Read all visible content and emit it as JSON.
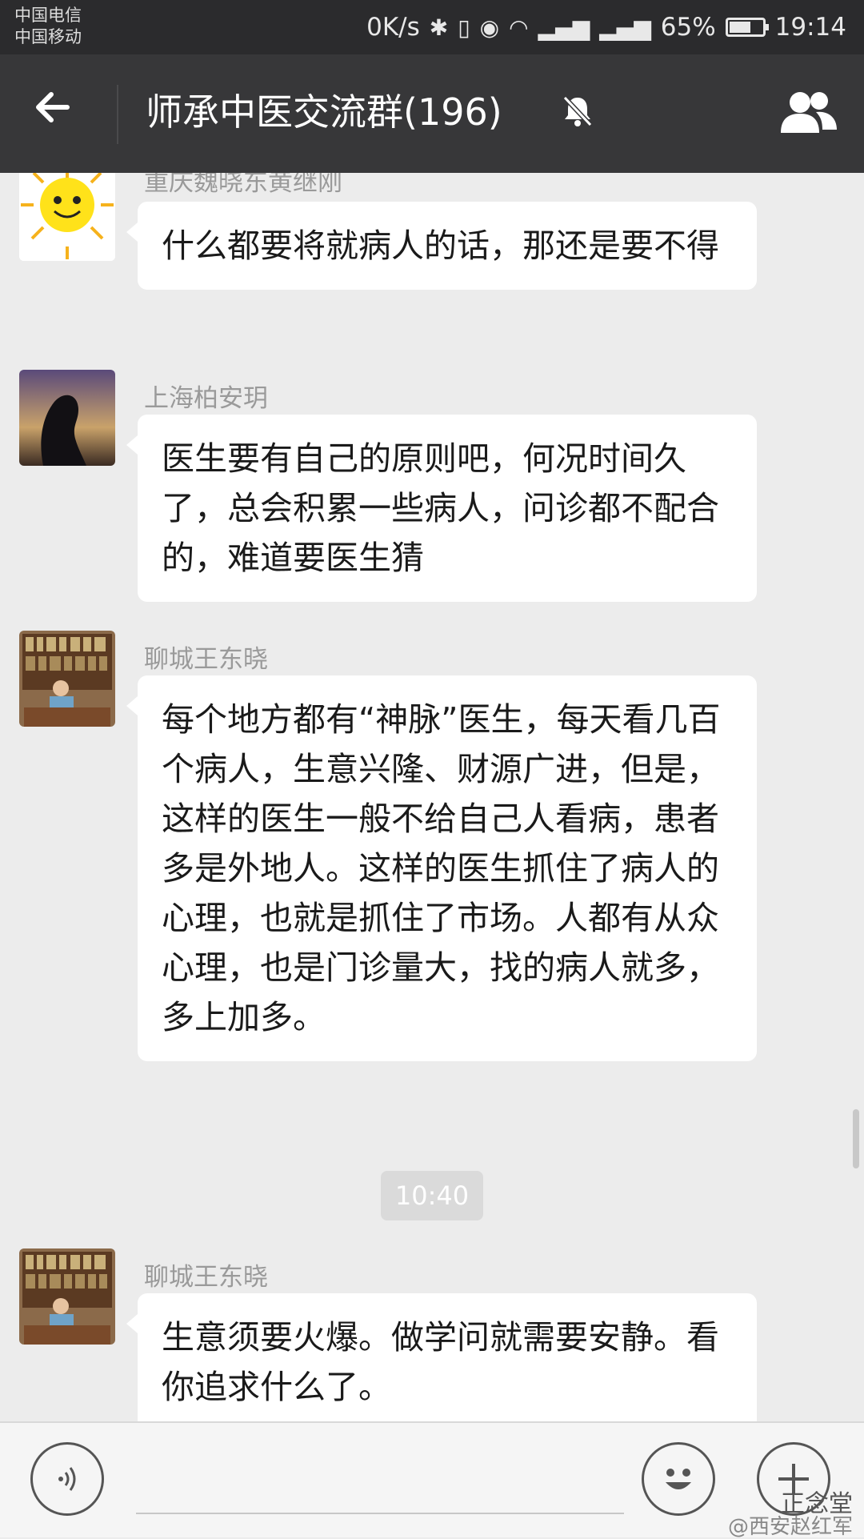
{
  "status_bar": {
    "carrier_1": "中国电信",
    "carrier_2": "中国移动",
    "net_speed": "0K/s",
    "battery": "65%",
    "battery_level": 0.65,
    "time": "19:14"
  },
  "header": {
    "title": "师承中医交流群(196)",
    "back_icon": "back-arrow-icon",
    "mute_icon": "bell-off-icon",
    "members_icon": "group-members-icon"
  },
  "messages": [
    {
      "sender": "重庆魏晓东黄继刚",
      "text": "什么都要将就病人的话，那还是要不得"
    },
    {
      "sender": "上海柏安玥",
      "text": "医生要有自己的原则吧，何况时间久了，总会积累一些病人，问诊都不配合的，难道要医生猜"
    },
    {
      "sender": "聊城王东晓",
      "text": "每个地方都有“神脉”医生，每天看几百个病人，生意兴隆、财源广进，但是，这样的医生一般不给自己人看病，患者多是外地人。这样的医生抓住了病人的心理，也就是抓住了市场。人都有从众心理，也是门诊量大，找的病人就多，多上加多。"
    },
    {
      "sender": "聊城王东晓",
      "text": "生意须要火爆。做学问就需要安静。看你追求什么了。"
    }
  ],
  "timestamp": "10:40",
  "input_bar": {
    "voice_icon": "voice-icon",
    "emoji_icon": "emoji-icon",
    "plus_icon": "plus-icon"
  },
  "watermark": {
    "line1": "正念堂",
    "line2": "@西安赵红军"
  },
  "colors": {
    "titlebar": "#373739",
    "statusbar": "#2b2b2d",
    "chat_bg": "#ececec",
    "bubble": "#ffffff"
  }
}
